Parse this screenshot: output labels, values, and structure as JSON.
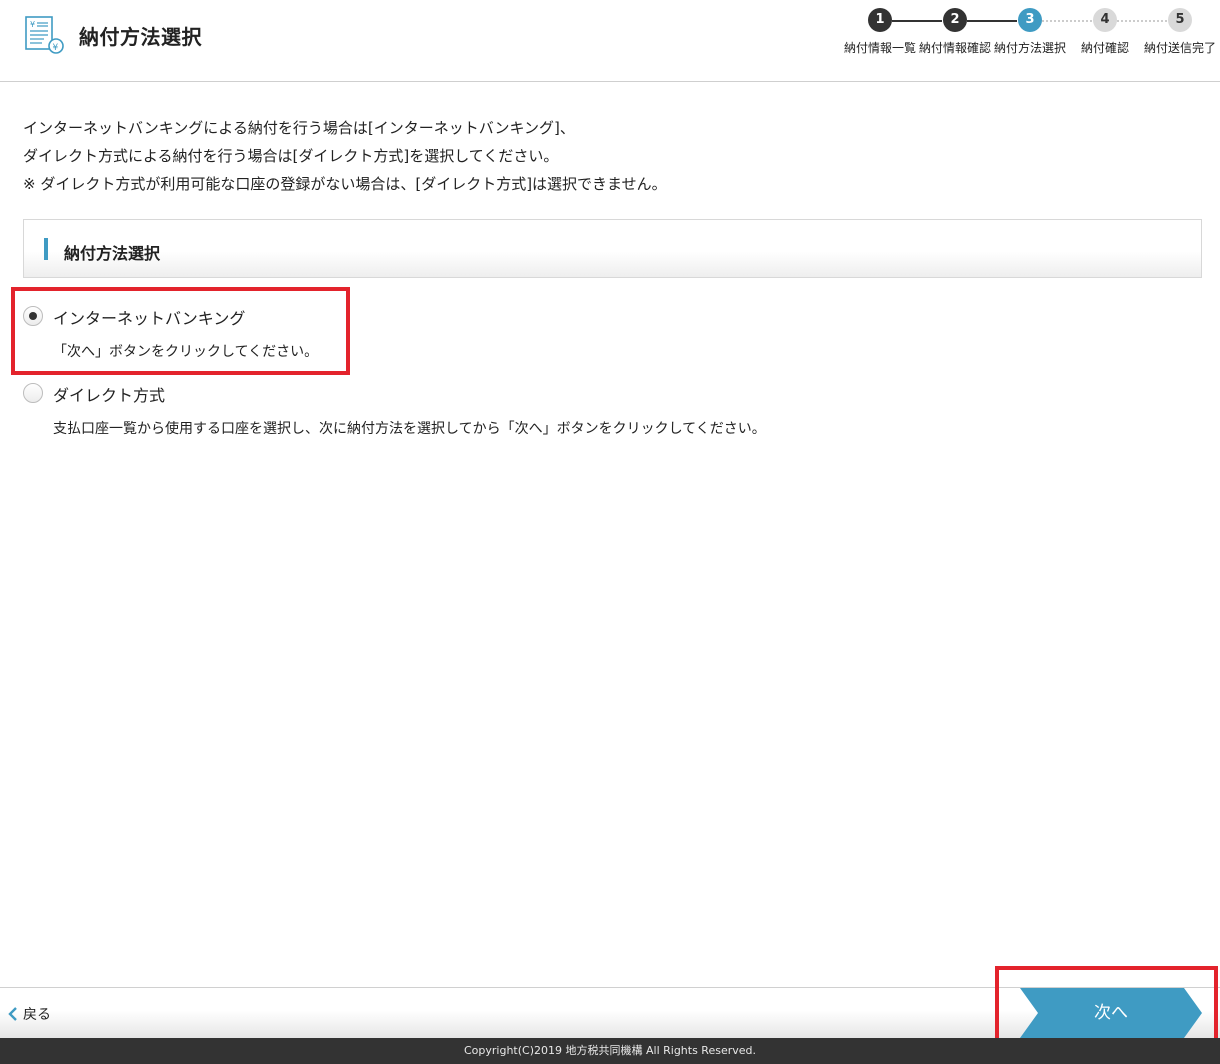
{
  "header": {
    "title": "納付方法選択",
    "logo_icon": "document-yen-icon"
  },
  "stepper": {
    "steps": [
      {
        "number": "1",
        "label": "納付情報一覧",
        "state": "done"
      },
      {
        "number": "2",
        "label": "納付情報確認",
        "state": "done"
      },
      {
        "number": "3",
        "label": "納付方法選択",
        "state": "current"
      },
      {
        "number": "4",
        "label": "納付確認",
        "state": "todo"
      },
      {
        "number": "5",
        "label": "納付送信完了",
        "state": "todo"
      }
    ]
  },
  "instructions": {
    "line1": "インターネットバンキングによる納付を行う場合は[インターネットバンキング]、",
    "line2": "ダイレクト方式による納付を行う場合は[ダイレクト方式]を選択してください。",
    "line3": "※ ダイレクト方式が利用可能な口座の登録がない場合は、[ダイレクト方式]は選択できません。"
  },
  "section": {
    "title": "納付方法選択"
  },
  "options": [
    {
      "label": "インターネットバンキング",
      "description": "「次へ」ボタンをクリックしてください。",
      "selected": true
    },
    {
      "label": "ダイレクト方式",
      "description": "支払口座一覧から使用する口座を選択し、次に納付方法を選択してから「次へ」ボタンをクリックしてください。",
      "selected": false
    }
  ],
  "footer": {
    "back_label": "戻る",
    "next_label": "次へ",
    "copyright": "Copyright(C)2019 地方税共同機構 All Rights Reserved."
  },
  "colors": {
    "accent": "#3f9bc3",
    "step_done": "#333333",
    "step_todo": "#d9d9d9",
    "highlight": "#e3232c",
    "footer_bar": "#333333"
  }
}
